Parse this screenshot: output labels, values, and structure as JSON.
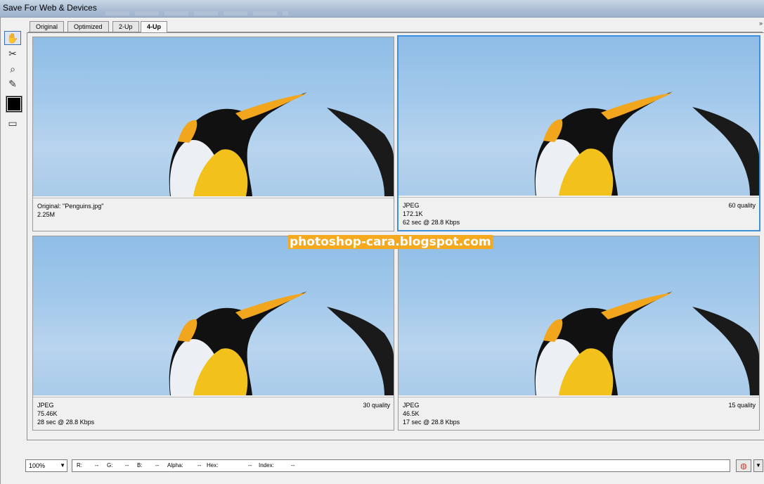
{
  "window": {
    "title": "Save For Web & Devices"
  },
  "tabs": [
    {
      "label": "Original"
    },
    {
      "label": "Optimized"
    },
    {
      "label": "2-Up"
    },
    {
      "label": "4-Up"
    }
  ],
  "active_tab": "4-Up",
  "tools": [
    {
      "icon": "hand-icon"
    },
    {
      "icon": "slice-select-icon"
    },
    {
      "icon": "zoom-icon"
    },
    {
      "icon": "eyedropper-icon"
    },
    {
      "icon": "eyedropper-color-swatch"
    },
    {
      "icon": "toggle-slices-icon"
    }
  ],
  "eyedropper_color": "#000000",
  "panels": [
    {
      "line1": "Original: \"Penguins.jpg\"",
      "line2": "2.25M",
      "line3": "",
      "quality": ""
    },
    {
      "line1": "JPEG",
      "line2": "172.1K",
      "line3": "62 sec @ 28.8 Kbps",
      "quality": "60 quality"
    },
    {
      "line1": "JPEG",
      "line2": "75.46K",
      "line3": "28 sec @ 28.8 Kbps",
      "quality": "30 quality"
    },
    {
      "line1": "JPEG",
      "line2": "46.5K",
      "line3": "17 sec @ 28.8 Kbps",
      "quality": "15 quality"
    }
  ],
  "selected_panel": 2,
  "watermark": "photoshop-cara.blogspot.com",
  "status": {
    "zoom": "100%",
    "r_label": "R:",
    "r_value": "--",
    "g_label": "G:",
    "g_value": "--",
    "b_label": "B:",
    "b_value": "--",
    "alpha_label": "Alpha:",
    "alpha_value": "--",
    "hex_label": "Hex:",
    "hex_value": "--",
    "index_label": "Index:",
    "index_value": "--"
  },
  "colors": {
    "selection": "#3d8fe0",
    "watermark_bg": "#f4a91f"
  }
}
